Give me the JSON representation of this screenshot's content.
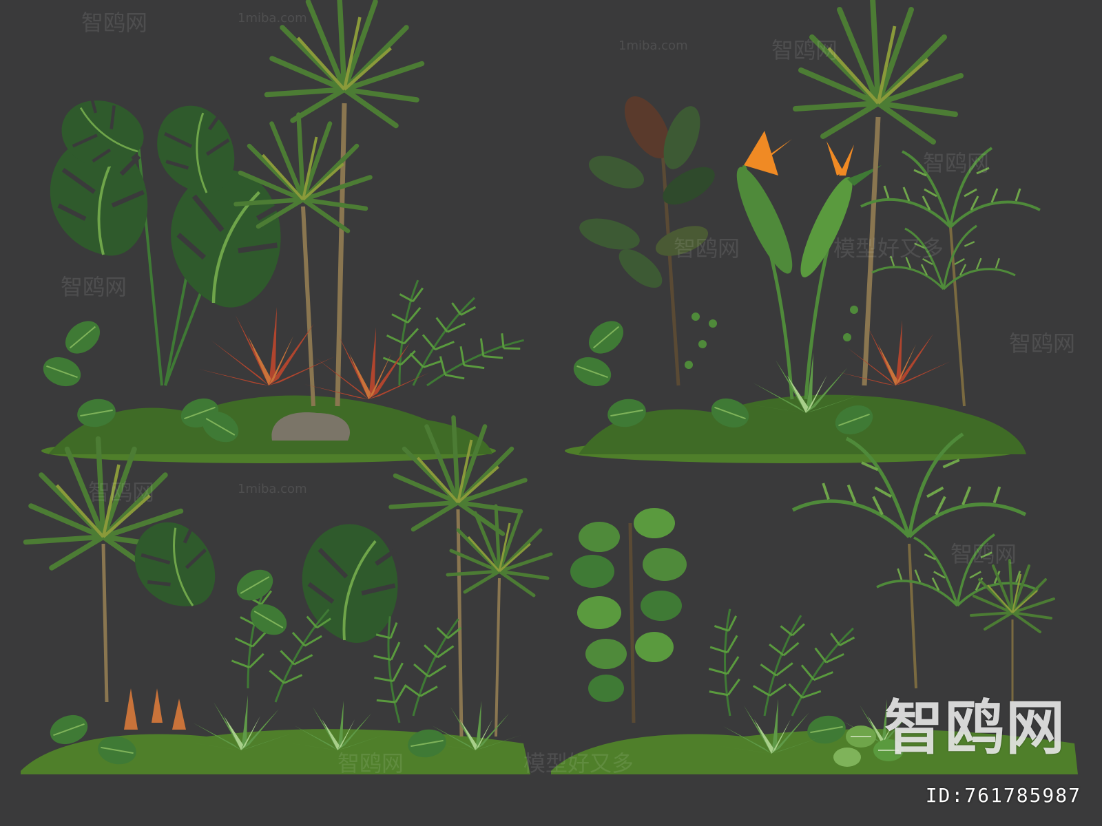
{
  "watermarks": {
    "brand_cn": "智鸥网",
    "site": "1miba.com",
    "model_text": "模型好又多",
    "id_label": "ID:761785987"
  },
  "colors": {
    "background": "#3a3a3b",
    "leaf_dark": "#2f5a2c",
    "leaf_mid": "#3f7a35",
    "leaf_light": "#6fa54a",
    "bromeliad_red": "#b0452e",
    "bromeliad_orange": "#c9733a",
    "bird_of_paradise": "#f08a24",
    "moss": "#4f7f2a",
    "rock": "#7b7568",
    "trunk": "#8a7650"
  },
  "panels": [
    {
      "name": "top-left-arrangement",
      "plants": [
        "monstera-icon",
        "dracaena-icon",
        "bromeliad-icon",
        "fern-icon",
        "moss-icon",
        "rock-icon"
      ]
    },
    {
      "name": "top-right-arrangement",
      "plants": [
        "rubber-plant-icon",
        "bird-of-paradise-icon",
        "dracaena-icon",
        "bromeliad-icon",
        "palm-icon",
        "moss-icon"
      ]
    },
    {
      "name": "bottom-left-arrangement",
      "plants": [
        "palm-icon",
        "monstera-icon",
        "dracaena-icon",
        "bromeliad-icon",
        "pitcher-plant-icon",
        "moss-icon"
      ]
    },
    {
      "name": "bottom-right-arrangement",
      "plants": [
        "fiddle-leaf-fig-icon",
        "palm-icon",
        "bromeliad-icon",
        "fittonia-icon",
        "moss-icon"
      ]
    }
  ]
}
